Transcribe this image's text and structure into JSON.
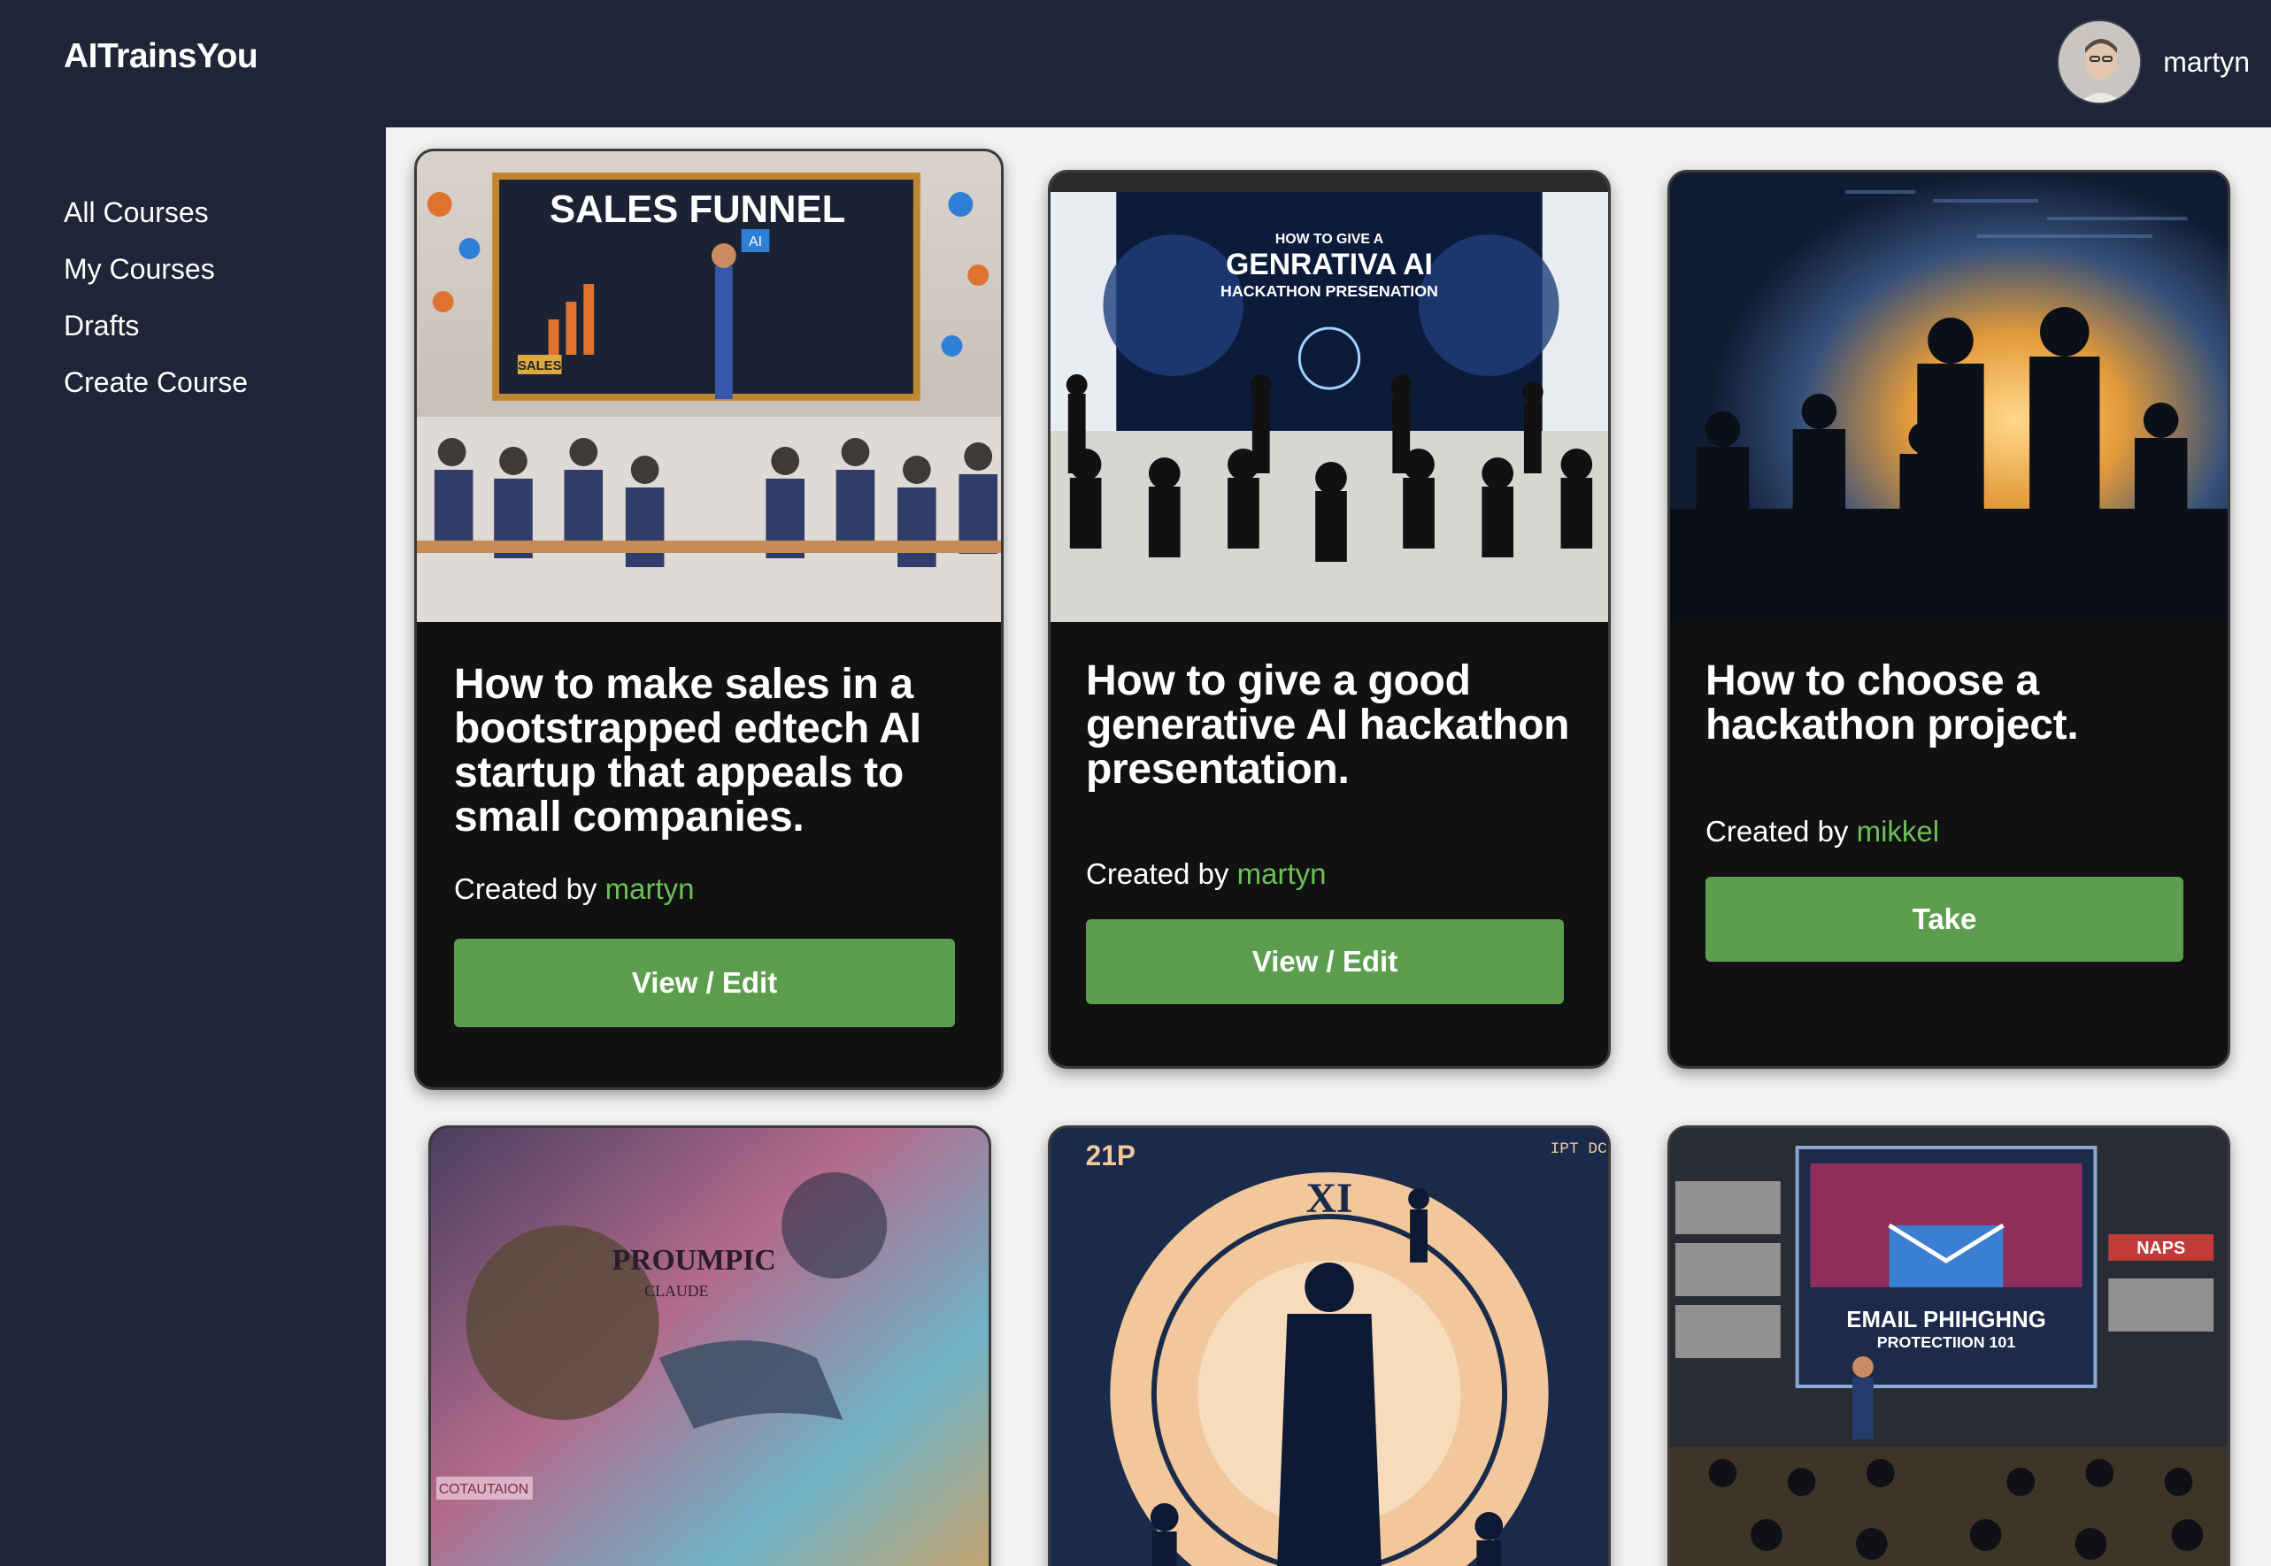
{
  "app": {
    "brand": "AITrainsYou",
    "user": {
      "name": "martyn"
    }
  },
  "sidebar": {
    "items": [
      {
        "label": "All Courses"
      },
      {
        "label": "My Courses"
      },
      {
        "label": "Drafts"
      },
      {
        "label": "Create Course"
      }
    ]
  },
  "courses": [
    {
      "title": "How to make sales in a bootstrapped edtech AI startup that appeals to small companies.",
      "created_by_label": "Created by",
      "author": "martyn",
      "action": "View / Edit",
      "image_text": [
        "SALES FUNNEL",
        "SALES",
        "AI"
      ]
    },
    {
      "title": "How to give a good generative AI hackathon presentation.",
      "created_by_label": "Created by",
      "author": "martyn",
      "action": "View / Edit",
      "image_text": [
        "HOW TO GIVE A",
        "GENRATIVA AI",
        "HACKATHON  PRESENATION"
      ]
    },
    {
      "title": "How to choose a hackathon project.",
      "created_by_label": "Created by",
      "author": "mikkel",
      "action": "Take"
    },
    {
      "image_text": [
        "PROUMPIC",
        "CLAUDE",
        "COTAUTAION"
      ]
    },
    {
      "image_text": [
        "21P",
        "IPT DC",
        "XI"
      ]
    },
    {
      "image_text": [
        "EMAIL  PHIHGHNG",
        "PROTECTIION  101",
        "NAPS"
      ]
    }
  ],
  "colors": {
    "background": "#1f2536",
    "content_background": "#f2f2f2",
    "card": "#111111",
    "accent_button": "#5c9e4e",
    "author_link": "#6dbf5a"
  }
}
